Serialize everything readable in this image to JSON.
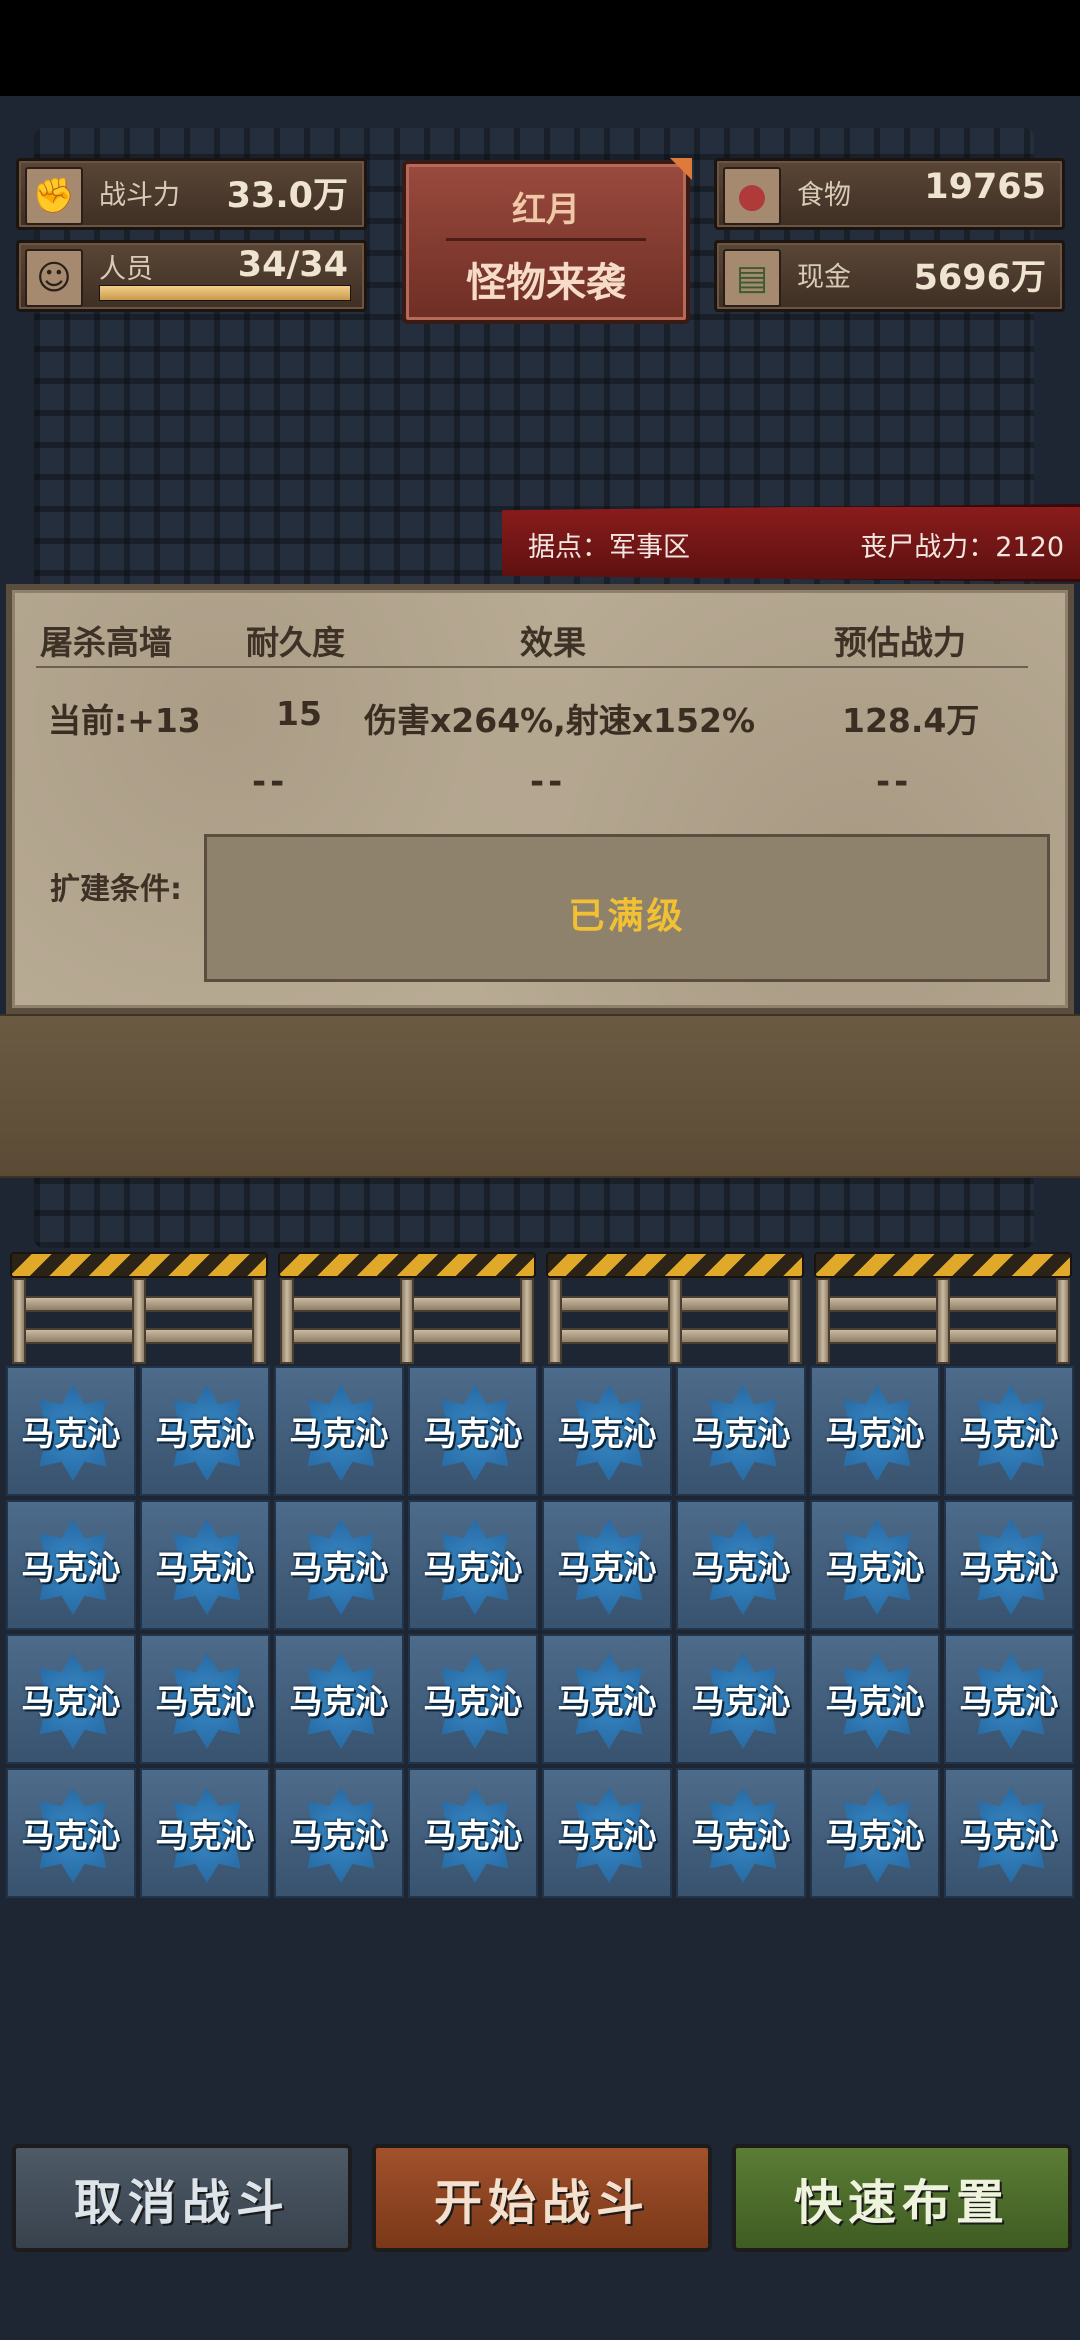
{
  "stats": {
    "combat_power": {
      "label": "战斗力",
      "value": "33.0万",
      "icon": "fist-icon"
    },
    "personnel": {
      "label": "人员",
      "value": "34/34",
      "icon": "person-icon",
      "fill": 1.0
    },
    "food": {
      "label": "食物",
      "value": "19765",
      "icon": "meat-icon"
    },
    "cash": {
      "label": "现金",
      "value": "5696万",
      "icon": "cash-icon"
    }
  },
  "event": {
    "line1": "红月",
    "line2": "怪物来袭"
  },
  "banner": {
    "location": "据点：军事区",
    "zombie_power": "丧尸战力：2120"
  },
  "wall_panel": {
    "headers": [
      "屠杀高墙",
      "耐久度",
      "效果",
      "预估战力"
    ],
    "current": [
      "当前:+13",
      "15",
      "伤害x264%,射速x152%",
      "128.4万"
    ],
    "next": [
      "--",
      "--",
      "--"
    ],
    "condition_label": "扩建条件:",
    "condition_value": "已满级"
  },
  "grid": {
    "unit_name": "马克沁",
    "rows": 4,
    "cols": 8
  },
  "buttons": {
    "cancel": "取消战斗",
    "start": "开始战斗",
    "quick": "快速布置"
  },
  "colors": {
    "event_red": "#9a4a3e",
    "max_level_gold": "#f2c033",
    "cell_blue": "#3a8ac4"
  }
}
